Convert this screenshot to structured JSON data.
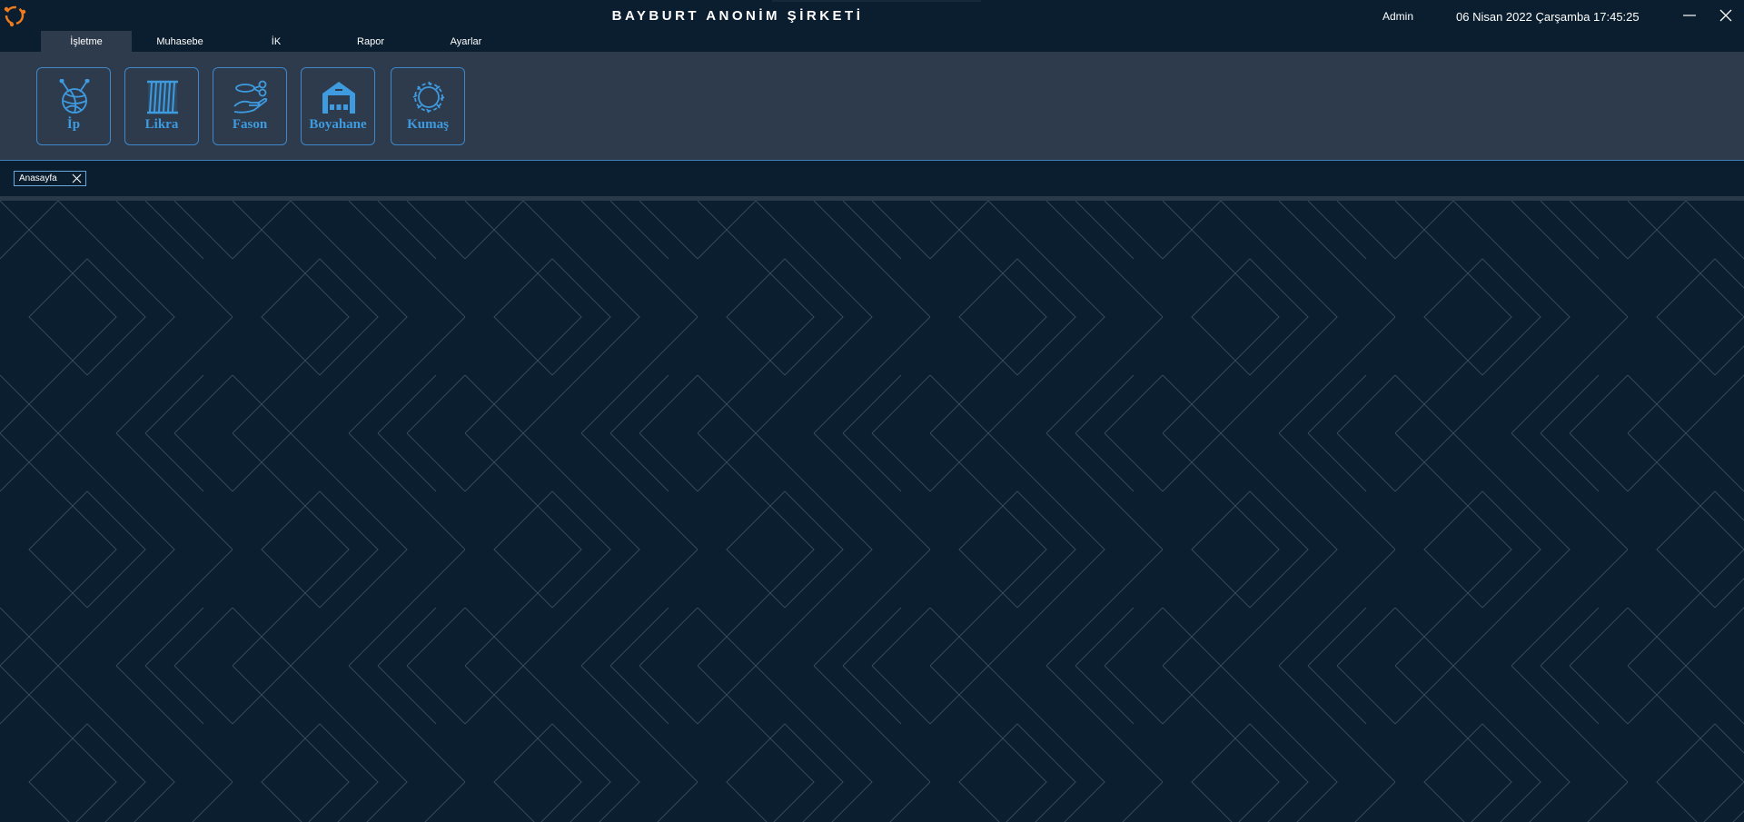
{
  "header": {
    "title": "BAYBURT ANONİM ŞİRKETİ",
    "user": "Admin",
    "datetime": "06 Nisan 2022 Çarşamba 17:45:25"
  },
  "menu": {
    "tabs": [
      {
        "label": "İşletme",
        "active": true
      },
      {
        "label": "Muhasebe",
        "active": false
      },
      {
        "label": "İK",
        "active": false
      },
      {
        "label": "Rapor",
        "active": false
      },
      {
        "label": "Ayarlar",
        "active": false
      }
    ]
  },
  "ribbon": {
    "tools": [
      {
        "label": "İp",
        "icon": "yarn-ball-icon"
      },
      {
        "label": "Likra",
        "icon": "spool-icon"
      },
      {
        "label": "Fason",
        "icon": "hand-thread-icon"
      },
      {
        "label": "Boyahane",
        "icon": "warehouse-icon"
      },
      {
        "label": "Kumaş",
        "icon": "fabric-wreath-icon"
      }
    ]
  },
  "documents": {
    "tabs": [
      {
        "label": "Anasayfa"
      }
    ]
  },
  "colors": {
    "background": "#0b1e2f",
    "ribbon": "#2d3b4d",
    "accent": "#3f9be0",
    "pattern_line": "#34495b"
  }
}
